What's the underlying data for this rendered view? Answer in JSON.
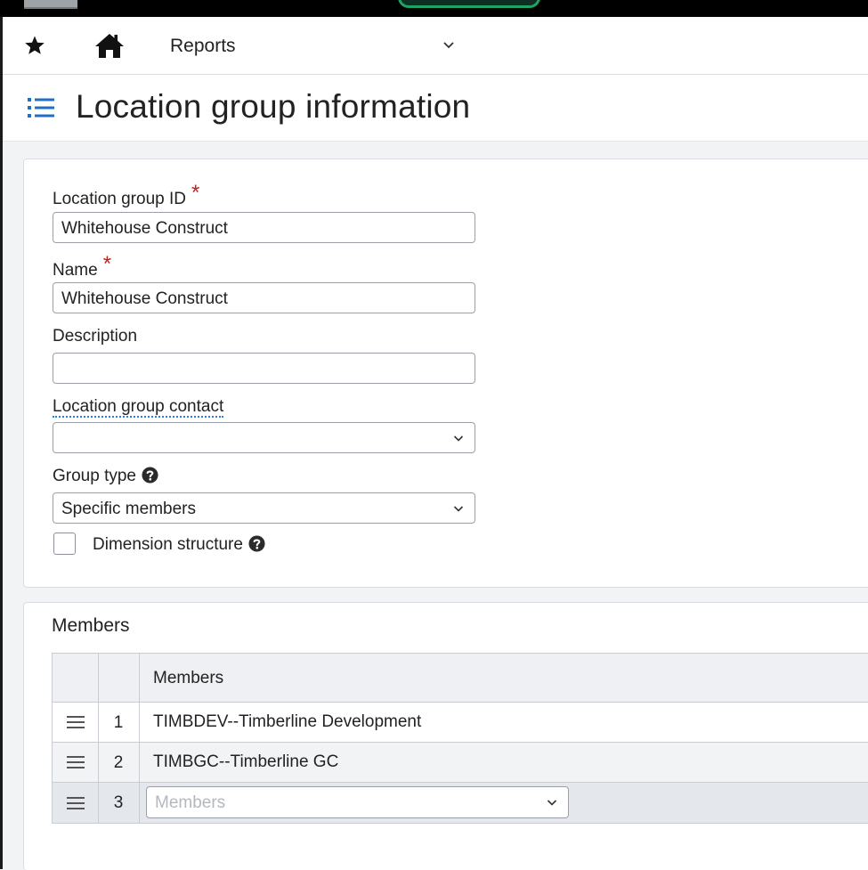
{
  "nav": {
    "reports_label": "Reports"
  },
  "page": {
    "title": "Location group information"
  },
  "form": {
    "id_label": "Location group ID",
    "id_value": "Whitehouse Construct",
    "required_mark": "*",
    "name_label": "Name",
    "name_value": "Whitehouse Construct",
    "description_label": "Description",
    "description_value": "",
    "contact_label": "Location group contact",
    "contact_value": "",
    "group_type_label": "Group type",
    "group_type_value": "Specific members",
    "dimension_label": "Dimension structure",
    "dimension_checked": false
  },
  "members": {
    "section_title": "Members",
    "column_header": "Members",
    "rows": [
      {
        "num": "1",
        "value": "TIMBDEV--Timberline Development"
      },
      {
        "num": "2",
        "value": "TIMBGC--Timberline GC"
      },
      {
        "num": "3",
        "placeholder": "Members"
      }
    ]
  },
  "icons": {
    "favorite": "star-icon",
    "home": "home-icon",
    "menu": "list-icon",
    "help": "question-circle-icon",
    "drag": "drag-handle-icon",
    "dropdown": "chevron-down-icon"
  },
  "colors": {
    "accent": "#1f6fc4",
    "required": "#c0211f"
  }
}
